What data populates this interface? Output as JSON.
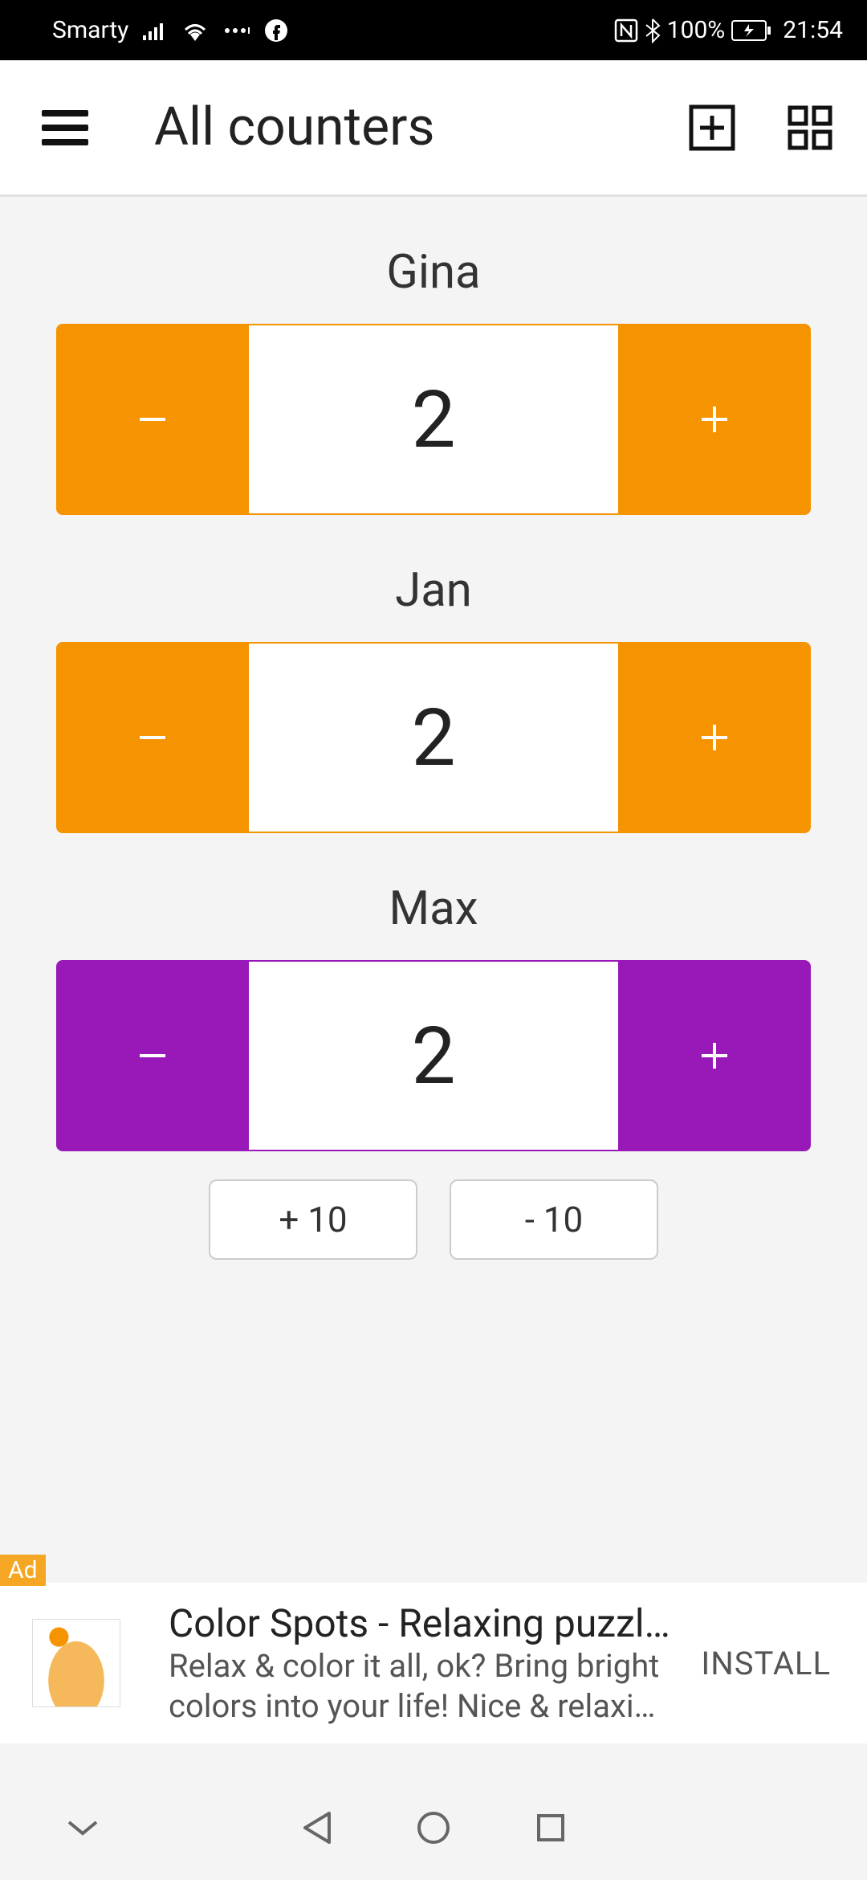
{
  "status_bar": {
    "carrier": "Smarty",
    "battery_pct": "100%",
    "time": "21:54"
  },
  "toolbar": {
    "title": "All counters"
  },
  "counters": [
    {
      "name": "Gina",
      "value": "2",
      "color": "orange"
    },
    {
      "name": "Jan",
      "value": "2",
      "color": "orange"
    },
    {
      "name": "Max",
      "value": "2",
      "color": "purple"
    }
  ],
  "extra_buttons": {
    "plus10": "+ 10",
    "minus10": "- 10"
  },
  "ad": {
    "badge": "Ad",
    "title": "Color Spots - Relaxing puzzle with d…",
    "description": "Relax & color it all, ok? Bring bright colors into your life! Nice & relaxing …",
    "cta": "INSTALL"
  },
  "colors": {
    "accent_orange": "#f59300",
    "accent_purple": "#9819b7"
  }
}
